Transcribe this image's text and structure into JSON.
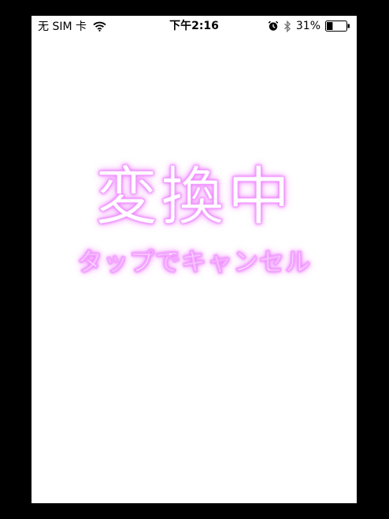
{
  "status_bar": {
    "carrier": "无 SIM 卡",
    "time": "下午2:16",
    "battery_percent": "31%",
    "battery_level": 0.31,
    "icons": [
      "wifi-icon",
      "alarm-icon",
      "bluetooth-icon",
      "battery-icon"
    ]
  },
  "overlay": {
    "title": "変換中",
    "hint": "タップでキャンセル",
    "glow_color": "#ee70ff"
  },
  "colors": {
    "frame": "#000000",
    "screen": "#ffffff"
  }
}
